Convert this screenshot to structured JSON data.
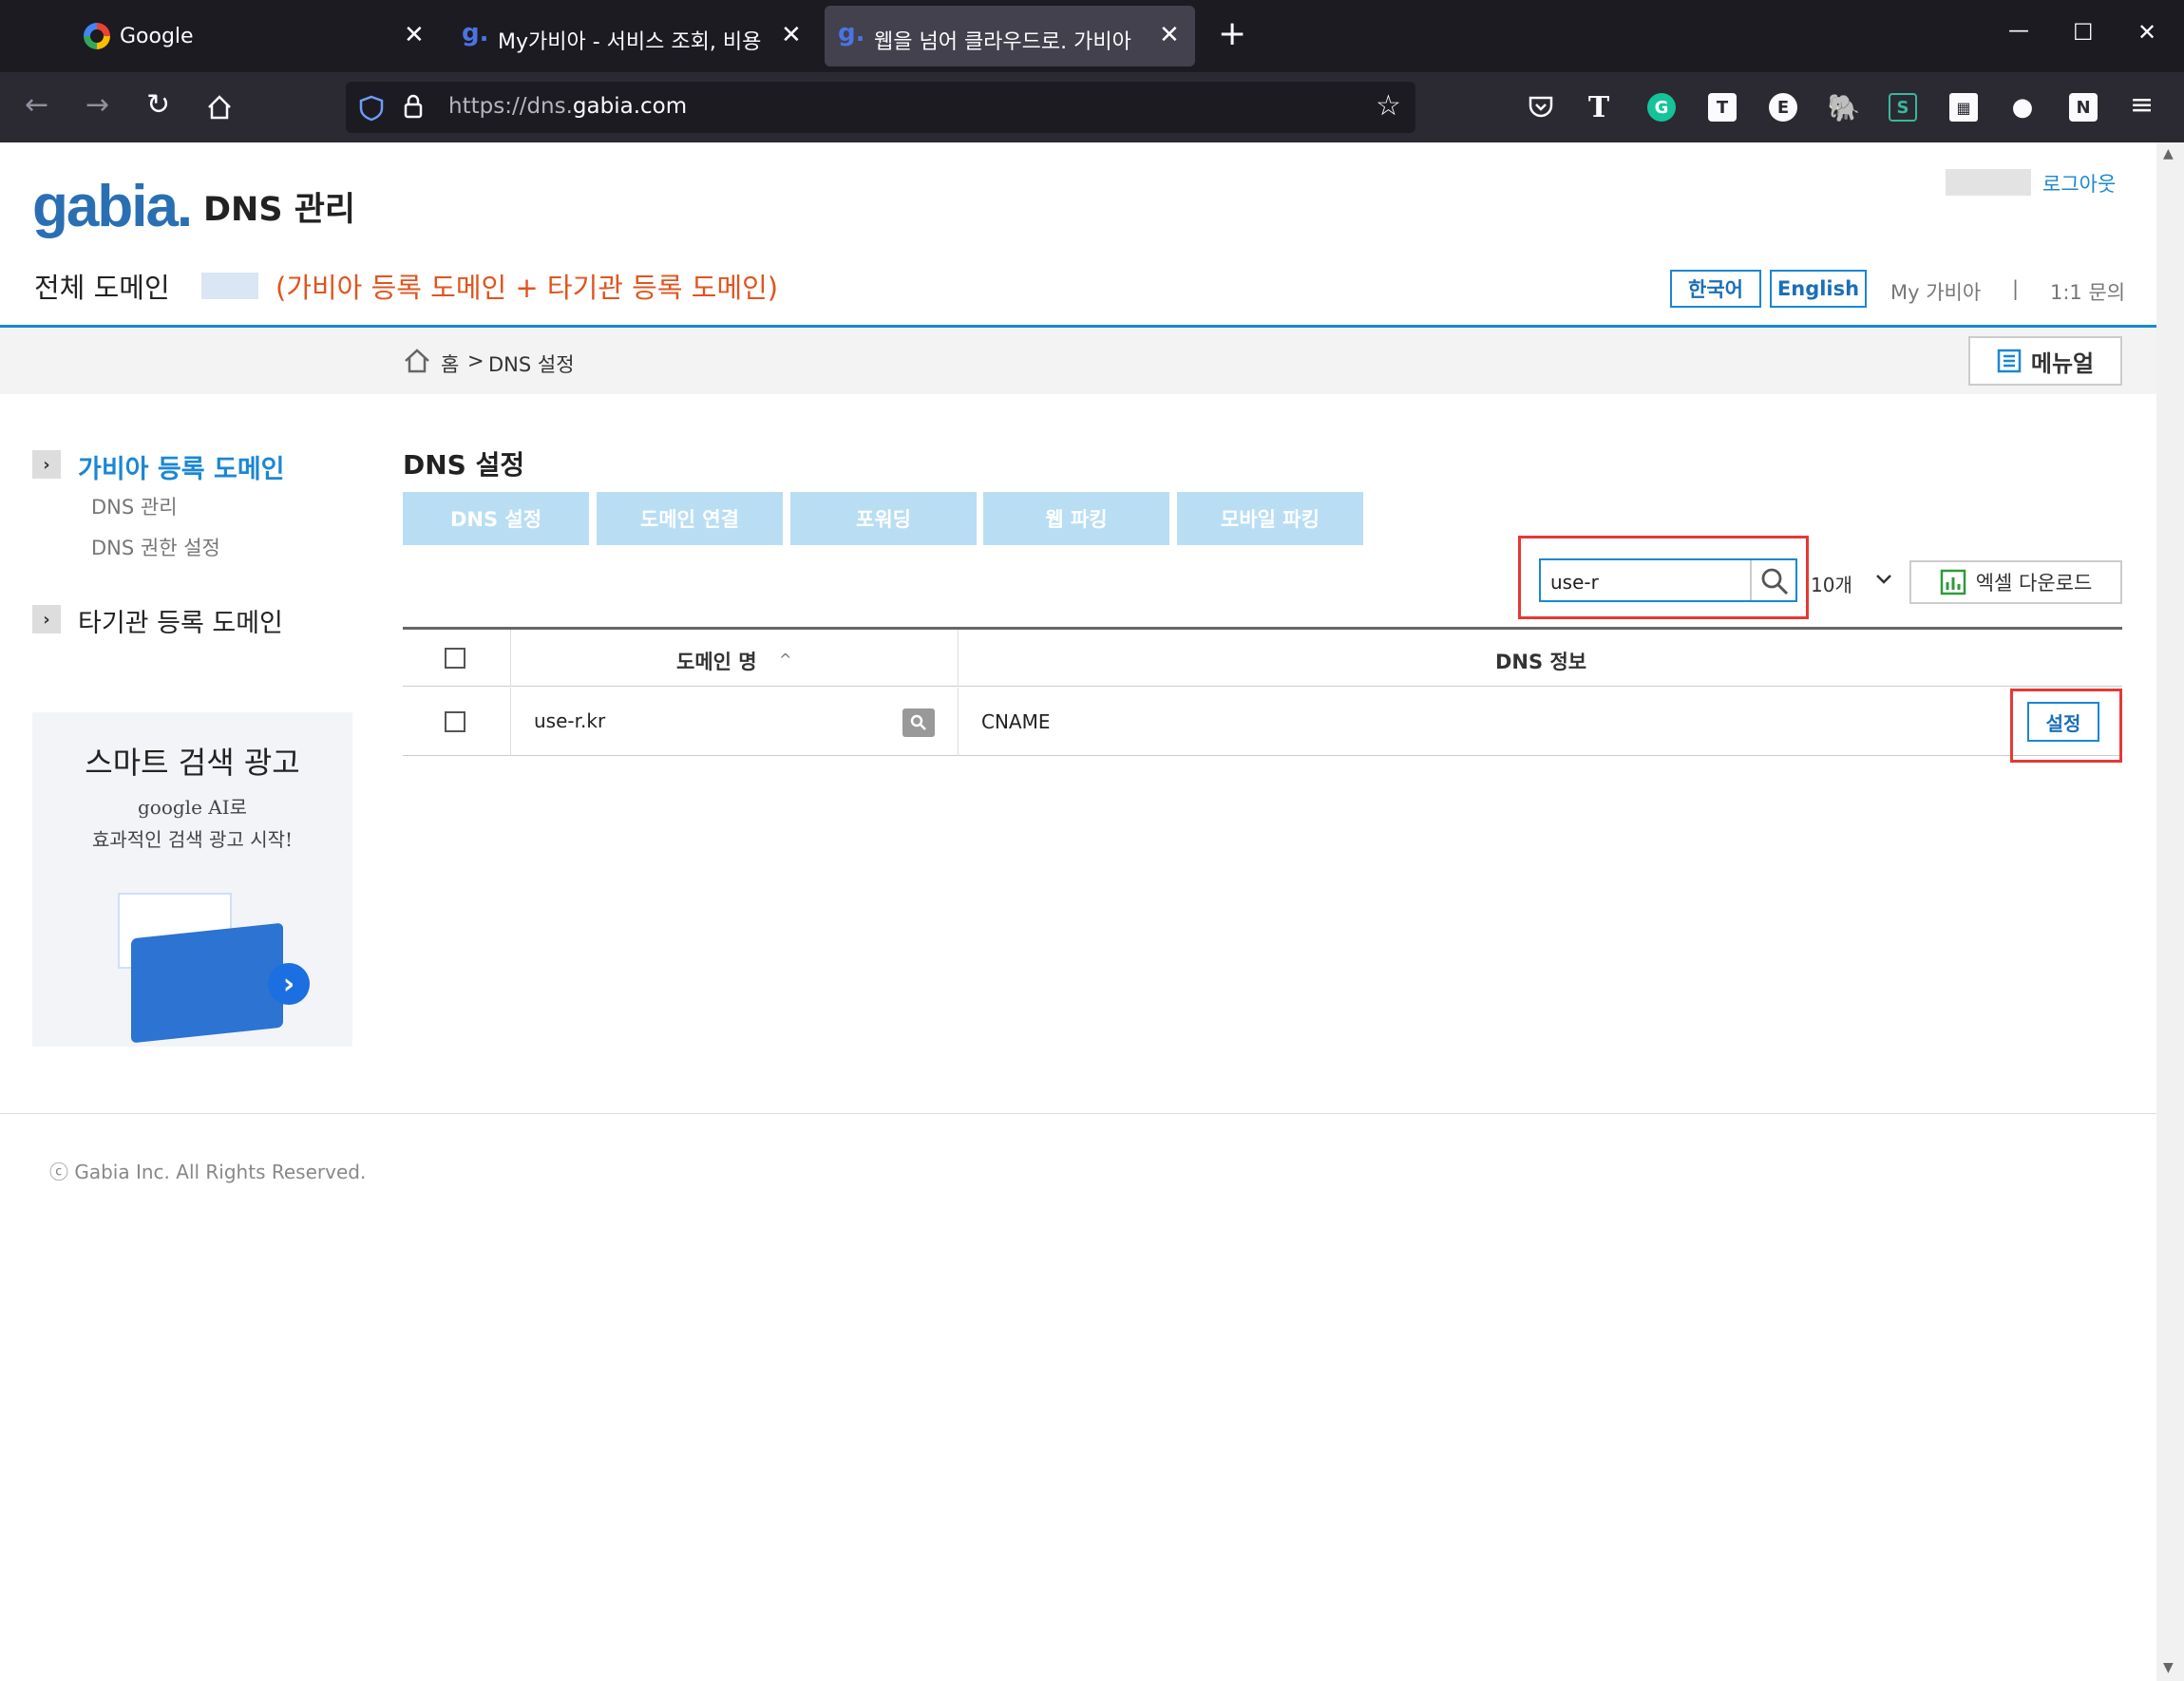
{
  "browser": {
    "tabs": [
      {
        "title": "Google",
        "favicon": "google-icon"
      },
      {
        "title": "My가비아 - 서비스 조회, 비용",
        "favicon": "gabia-icon"
      },
      {
        "title": "웹을 넘어 클라우드로. 가비아",
        "favicon": "gabia-icon"
      }
    ],
    "new_tab_glyph": "+",
    "close_glyph": "✕",
    "url_prefix": "https://dns.",
    "url_domain": "gabia.com",
    "window_controls": {
      "minimize": "—",
      "maximize": "☐",
      "close": "✕"
    }
  },
  "header": {
    "logo": "gabia.",
    "title": "DNS 관리",
    "logout": "로그아웃",
    "domain_label": "전체 도메인",
    "domain_note": "(가비아 등록 도메인 + 타기관 등록 도메인)",
    "lang_ko": "한국어",
    "lang_en": "English",
    "my_gabia": "My 가비아",
    "separator": "|",
    "inquiry": "1:1 문의"
  },
  "breadcrumb": {
    "home": "홈",
    "sep": ">",
    "current": "DNS 설정"
  },
  "manual_button": "메뉴얼",
  "sidebar": {
    "group1": "가비아 등록 도메인",
    "items": [
      "DNS 관리",
      "DNS 권한 설정"
    ],
    "group2": "타기관 등록 도메인"
  },
  "ad": {
    "title": "스마트 검색 광고",
    "line1": "google AI로",
    "line2": "효과적인 검색 광고 시작!"
  },
  "main": {
    "title": "DNS 설정",
    "tabs": [
      "DNS 설정",
      "도메인 연결",
      "포워딩",
      "웹 파킹",
      "모바일 파킹"
    ],
    "search_value": "use-r",
    "page_size": "10개",
    "excel_button": "엑셀 다운로드",
    "columns": {
      "domain": "도메인 명",
      "sort": "^",
      "dns": "DNS 정보"
    },
    "rows": [
      {
        "domain": "use-r.kr",
        "dns": "CNAME",
        "action": "설정"
      }
    ]
  },
  "footer": {
    "copyright": "ⓒ Gabia Inc. All Rights Reserved."
  },
  "colors": {
    "accent": "#1b87d3",
    "highlight": "#e53935",
    "note": "#e0541f",
    "tab_disabled": "#b9def3"
  }
}
